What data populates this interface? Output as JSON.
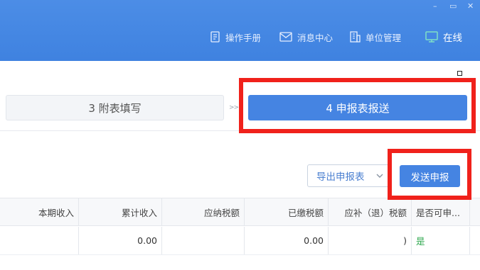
{
  "window_controls": {
    "minimize": "–",
    "maximize": "▭",
    "close": "✕"
  },
  "header_nav": [
    {
      "label": "操作手册",
      "icon": "manual-icon"
    },
    {
      "label": "消息中心",
      "icon": "mail-icon"
    },
    {
      "label": "单位管理",
      "icon": "building-icon"
    },
    {
      "label": "在线",
      "icon": "monitor-icon"
    }
  ],
  "steps": {
    "step3_label": "3 附表填写",
    "separator": ">>",
    "step4_label": "4 申报表报送"
  },
  "actions": {
    "export_label": "导出申报表",
    "send_label": "发送申报"
  },
  "table": {
    "headers": [
      "本期收入",
      "累计收入",
      "应纳税额",
      "已缴税额",
      "应补（退）税额",
      "是否可申..."
    ],
    "row": [
      "",
      "0.00",
      "",
      "0.00",
      ")",
      "是"
    ]
  },
  "colors": {
    "header_blue": "#4c8de6",
    "primary": "#4584e2",
    "highlight_red": "#f0211b",
    "yes_green": "#2fa84f"
  }
}
